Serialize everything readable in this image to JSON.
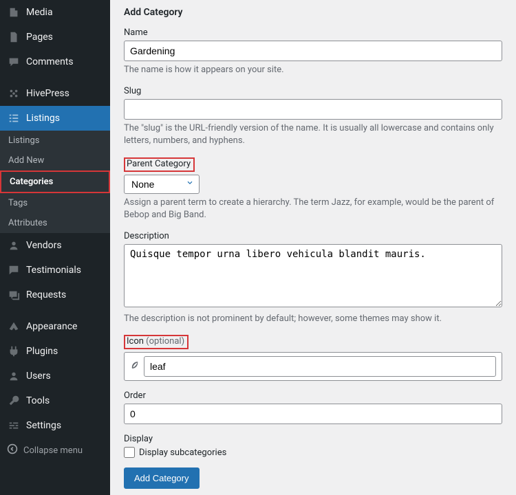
{
  "sidebar": {
    "items": [
      {
        "label": "Media"
      },
      {
        "label": "Pages"
      },
      {
        "label": "Comments"
      },
      {
        "label": "HivePress"
      },
      {
        "label": "Listings"
      },
      {
        "label": "Vendors"
      },
      {
        "label": "Testimonials"
      },
      {
        "label": "Requests"
      },
      {
        "label": "Appearance"
      },
      {
        "label": "Plugins"
      },
      {
        "label": "Users"
      },
      {
        "label": "Tools"
      },
      {
        "label": "Settings"
      }
    ],
    "submenu": [
      {
        "label": "Listings"
      },
      {
        "label": "Add New"
      },
      {
        "label": "Categories"
      },
      {
        "label": "Tags"
      },
      {
        "label": "Attributes"
      }
    ],
    "collapse": "Collapse menu"
  },
  "page": {
    "title": "Add Category",
    "name_label": "Name",
    "name_value": "Gardening",
    "name_desc": "The name is how it appears on your site.",
    "slug_label": "Slug",
    "slug_value": "",
    "slug_desc": "The \"slug\" is the URL-friendly version of the name. It is usually all lowercase and contains only letters, numbers, and hyphens.",
    "parent_label": "Parent Category",
    "parent_value": "None",
    "parent_desc": "Assign a parent term to create a hierarchy. The term Jazz, for example, would be the parent of Bebop and Big Band.",
    "desc_label": "Description",
    "desc_value": "Quisque tempor urna libero vehicula blandit mauris.",
    "desc_desc": "The description is not prominent by default; however, some themes may show it.",
    "icon_label": "Icon ",
    "icon_optional": "(optional)",
    "icon_value": "leaf",
    "order_label": "Order",
    "order_value": "0",
    "display_label": "Display",
    "display_checkbox": "Display subcategories",
    "submit": "Add Category"
  }
}
